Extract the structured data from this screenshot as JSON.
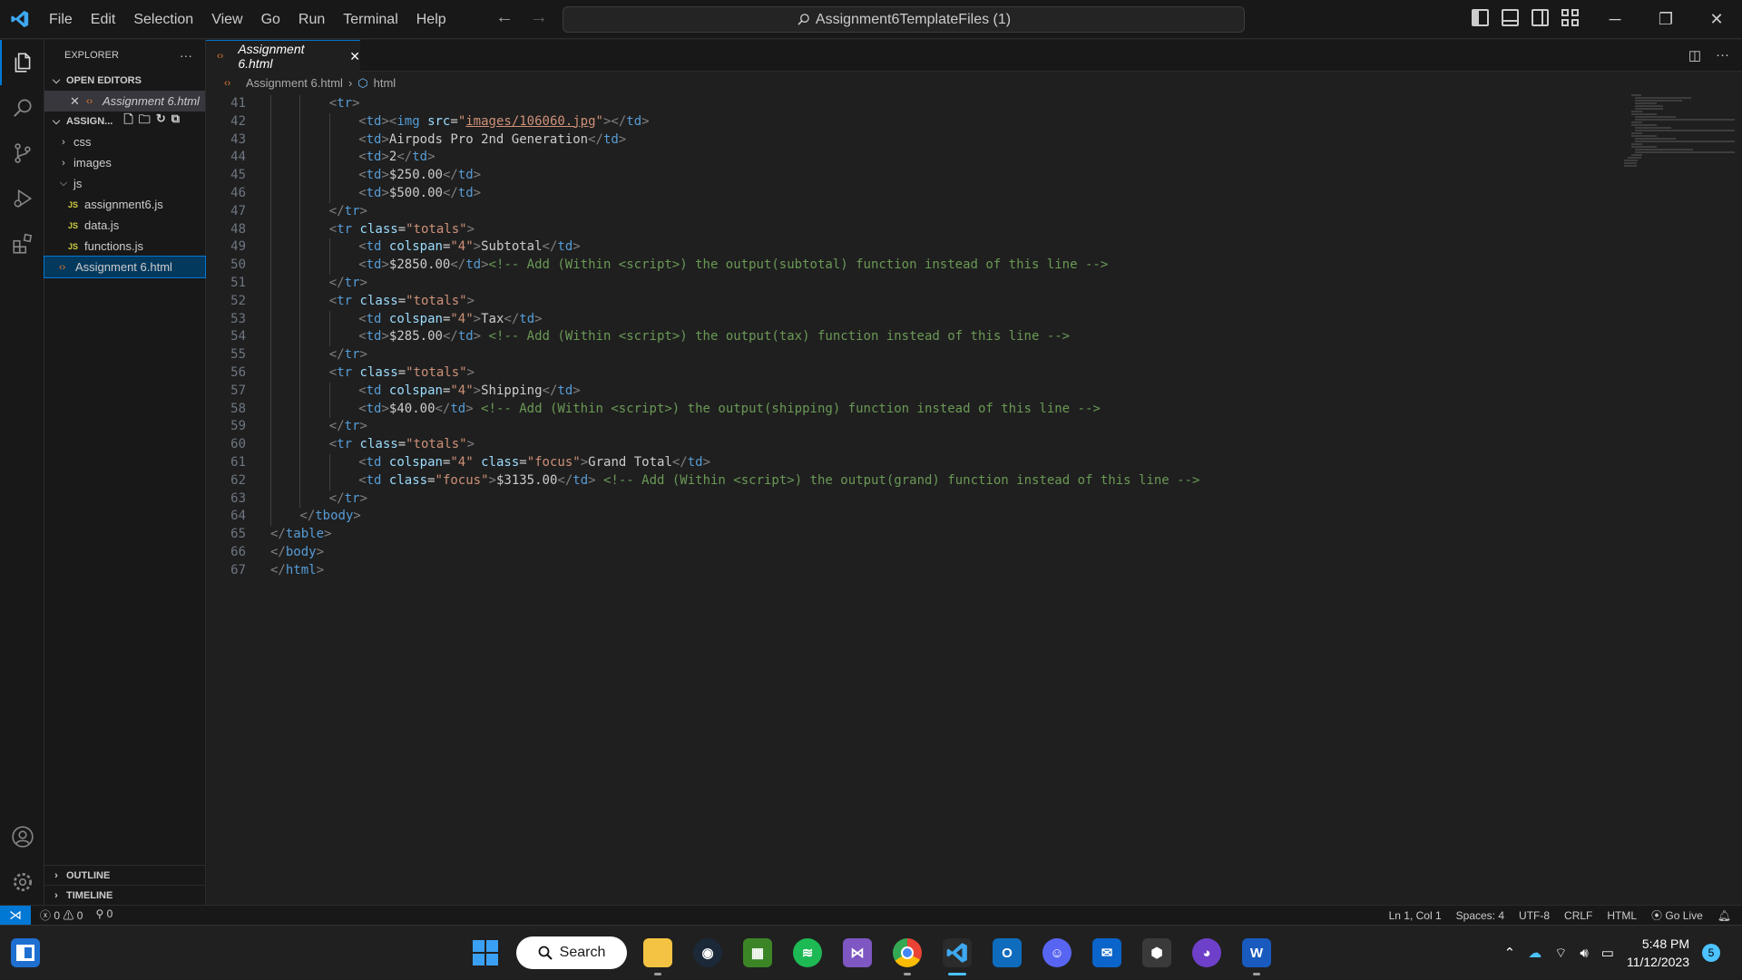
{
  "titlebar": {
    "menu": [
      "File",
      "Edit",
      "Selection",
      "View",
      "Go",
      "Run",
      "Terminal",
      "Help"
    ],
    "command_center": "Assignment6TemplateFiles (1)"
  },
  "sidebar": {
    "header": "EXPLORER",
    "open_editors_label": "OPEN EDITORS",
    "open_editor_file": "Assignment 6.html",
    "folder_label": "ASSIGN...",
    "tree": [
      {
        "type": "folder",
        "label": "css",
        "expanded": false
      },
      {
        "type": "folder",
        "label": "images",
        "expanded": false
      },
      {
        "type": "folder",
        "label": "js",
        "expanded": true
      },
      {
        "type": "js",
        "label": "assignment6.js"
      },
      {
        "type": "js",
        "label": "data.js"
      },
      {
        "type": "js",
        "label": "functions.js"
      },
      {
        "type": "html",
        "label": "Assignment 6.html",
        "selected": true
      }
    ],
    "outline_label": "OUTLINE",
    "timeline_label": "TIMELINE"
  },
  "editor": {
    "tab_label": "Assignment 6.html",
    "breadcrumb_file": "Assignment 6.html",
    "breadcrumb_symbol": "html",
    "lines": [
      {
        "n": "41",
        "indent": 2,
        "html": "<span class='b'>&lt;</span><span class='t'>tr</span><span class='b'>&gt;</span>"
      },
      {
        "n": "42",
        "indent": 3,
        "html": "<span class='b'>&lt;</span><span class='t'>td</span><span class='b'>&gt;&lt;</span><span class='t'>img</span> <span class='a'>src</span>=<span class='s'>\"</span><span class='s link'>images/106060.jpg</span><span class='s'>\"</span><span class='b'>&gt;&lt;/</span><span class='t'>td</span><span class='b'>&gt;</span>"
      },
      {
        "n": "43",
        "indent": 3,
        "html": "<span class='b'>&lt;</span><span class='t'>td</span><span class='b'>&gt;</span>Airpods Pro 2nd Generation<span class='b'>&lt;/</span><span class='t'>td</span><span class='b'>&gt;</span>"
      },
      {
        "n": "44",
        "indent": 3,
        "html": "<span class='b'>&lt;</span><span class='t'>td</span><span class='b'>&gt;</span>2<span class='b'>&lt;/</span><span class='t'>td</span><span class='b'>&gt;</span>"
      },
      {
        "n": "45",
        "indent": 3,
        "html": "<span class='b'>&lt;</span><span class='t'>td</span><span class='b'>&gt;</span>$250.00<span class='b'>&lt;/</span><span class='t'>td</span><span class='b'>&gt;</span>"
      },
      {
        "n": "46",
        "indent": 3,
        "html": "<span class='b'>&lt;</span><span class='t'>td</span><span class='b'>&gt;</span>$500.00<span class='b'>&lt;/</span><span class='t'>td</span><span class='b'>&gt;</span>"
      },
      {
        "n": "47",
        "indent": 2,
        "html": "<span class='b'>&lt;/</span><span class='t'>tr</span><span class='b'>&gt;</span>"
      },
      {
        "n": "48",
        "indent": 2,
        "html": "<span class='b'>&lt;</span><span class='t'>tr</span> <span class='a'>class</span>=<span class='s'>\"totals\"</span><span class='b'>&gt;</span>"
      },
      {
        "n": "49",
        "indent": 3,
        "html": "<span class='b'>&lt;</span><span class='t'>td</span> <span class='a'>colspan</span>=<span class='s'>\"4\"</span><span class='b'>&gt;</span>Subtotal<span class='b'>&lt;/</span><span class='t'>td</span><span class='b'>&gt;</span>"
      },
      {
        "n": "50",
        "indent": 3,
        "html": "<span class='b'>&lt;</span><span class='t'>td</span><span class='b'>&gt;</span>$2850.00<span class='b'>&lt;/</span><span class='t'>td</span><span class='b'>&gt;</span><span class='c'>&lt;!-- Add (Within &lt;script&gt;) the output(subtotal) function instead of this line --&gt;</span>"
      },
      {
        "n": "51",
        "indent": 2,
        "html": "<span class='b'>&lt;/</span><span class='t'>tr</span><span class='b'>&gt;</span>"
      },
      {
        "n": "52",
        "indent": 2,
        "html": "<span class='b'>&lt;</span><span class='t'>tr</span> <span class='a'>class</span>=<span class='s'>\"totals\"</span><span class='b'>&gt;</span>"
      },
      {
        "n": "53",
        "indent": 3,
        "html": "<span class='b'>&lt;</span><span class='t'>td</span> <span class='a'>colspan</span>=<span class='s'>\"4\"</span><span class='b'>&gt;</span>Tax<span class='b'>&lt;/</span><span class='t'>td</span><span class='b'>&gt;</span>"
      },
      {
        "n": "54",
        "indent": 3,
        "html": "<span class='b'>&lt;</span><span class='t'>td</span><span class='b'>&gt;</span>$285.00<span class='b'>&lt;/</span><span class='t'>td</span><span class='b'>&gt;</span> <span class='c'>&lt;!-- Add (Within &lt;script&gt;) the output(tax) function instead of this line --&gt;</span>"
      },
      {
        "n": "55",
        "indent": 2,
        "html": "<span class='b'>&lt;/</span><span class='t'>tr</span><span class='b'>&gt;</span>"
      },
      {
        "n": "56",
        "indent": 2,
        "html": "<span class='b'>&lt;</span><span class='t'>tr</span> <span class='a'>class</span>=<span class='s'>\"totals\"</span><span class='b'>&gt;</span>"
      },
      {
        "n": "57",
        "indent": 3,
        "html": "<span class='b'>&lt;</span><span class='t'>td</span> <span class='a'>colspan</span>=<span class='s'>\"4\"</span><span class='b'>&gt;</span>Shipping<span class='b'>&lt;/</span><span class='t'>td</span><span class='b'>&gt;</span>"
      },
      {
        "n": "58",
        "indent": 3,
        "html": "<span class='b'>&lt;</span><span class='t'>td</span><span class='b'>&gt;</span>$40.00<span class='b'>&lt;/</span><span class='t'>td</span><span class='b'>&gt;</span> <span class='c'>&lt;!-- Add (Within &lt;script&gt;) the output(shipping) function instead of this line --&gt;</span>"
      },
      {
        "n": "59",
        "indent": 2,
        "html": "<span class='b'>&lt;/</span><span class='t'>tr</span><span class='b'>&gt;</span>"
      },
      {
        "n": "60",
        "indent": 2,
        "html": "<span class='b'>&lt;</span><span class='t'>tr</span> <span class='a'>class</span>=<span class='s'>\"totals\"</span><span class='b'>&gt;</span>"
      },
      {
        "n": "61",
        "indent": 3,
        "html": "<span class='b'>&lt;</span><span class='t'>td</span> <span class='a'>colspan</span>=<span class='s'>\"4\"</span> <span class='a'>class</span>=<span class='s'>\"focus\"</span><span class='b'>&gt;</span>Grand Total<span class='b'>&lt;/</span><span class='t'>td</span><span class='b'>&gt;</span>"
      },
      {
        "n": "62",
        "indent": 3,
        "html": "<span class='b'>&lt;</span><span class='t'>td</span> <span class='a'>class</span>=<span class='s'>\"focus\"</span><span class='b'>&gt;</span>$3135.00<span class='b'>&lt;/</span><span class='t'>td</span><span class='b'>&gt;</span> <span class='c'>&lt;!-- Add (Within &lt;script&gt;) the output(grand) function instead of this line --&gt;</span>"
      },
      {
        "n": "63",
        "indent": 2,
        "html": "<span class='b'>&lt;/</span><span class='t'>tr</span><span class='b'>&gt;</span>"
      },
      {
        "n": "64",
        "indent": 1,
        "html": "<span class='b'>&lt;/</span><span class='t'>tbody</span><span class='b'>&gt;</span>"
      },
      {
        "n": "65",
        "indent": 0,
        "html": "<span class='b'>&lt;/</span><span class='t'>table</span><span class='b'>&gt;</span>"
      },
      {
        "n": "66",
        "indent": 0,
        "html": "<span class='b'>&lt;/</span><span class='t'>body</span><span class='b'>&gt;</span>"
      },
      {
        "n": "67",
        "indent": 0,
        "html": "<span class='b'>&lt;/</span><span class='t'>html</span><span class='b'>&gt;</span>"
      }
    ]
  },
  "statusbar": {
    "errors": "0",
    "warnings": "0",
    "ports": "0",
    "cursor": "Ln 1, Col 1",
    "spaces": "Spaces: 4",
    "encoding": "UTF-8",
    "eol": "CRLF",
    "language": "HTML",
    "go_live": "Go Live"
  },
  "taskbar": {
    "search_label": "Search",
    "time": "5:48 PM",
    "date": "11/12/2023",
    "notification_count": "5"
  },
  "colors": {
    "accent": "#0078d4",
    "editor_bg": "#1f1f1f",
    "chrome_bg": "#181818"
  }
}
